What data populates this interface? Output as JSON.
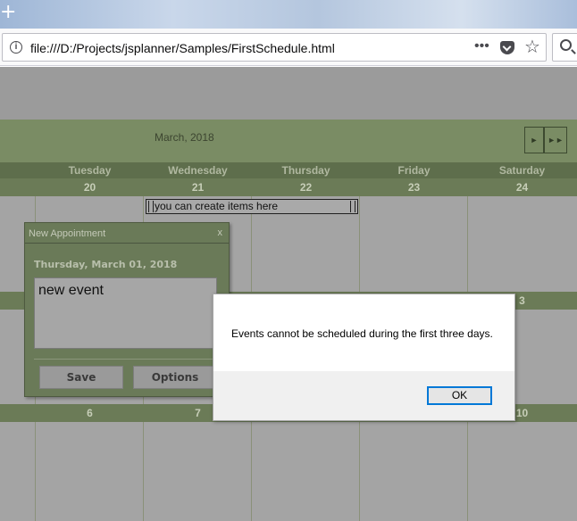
{
  "browser": {
    "url": "file:///D:/Projects/jsplanner/Samples/FirstSchedule.html",
    "more_glyph": "•••",
    "star_glyph": "☆",
    "plus_glyph": "+",
    "info_glyph": "i"
  },
  "calendar": {
    "month": "March, 2018",
    "nav_next": "►",
    "nav_fast": "►►",
    "day_names": [
      "Tuesday",
      "Wednesday",
      "Thursday",
      "Friday",
      "Saturday"
    ],
    "week1_dates": [
      "20",
      "21",
      "22",
      "23",
      "24"
    ],
    "week2_dates": [
      "3"
    ],
    "week3_dates": [
      "6",
      "7",
      "10"
    ],
    "item_text": "you can create items here"
  },
  "appointment": {
    "title": "New Appointment",
    "close": "x",
    "date": "Thursday, March 01, 2018",
    "text": "new event",
    "save_label": "Save",
    "options_label": "Options"
  },
  "dialog": {
    "message": "Events cannot be scheduled during the first three days.",
    "ok_label": "OK"
  },
  "colors": {
    "header_green": "#7a8c64",
    "dayname_bar": "#5e6e4c",
    "date_bar": "#6b7b57",
    "accent_blue": "#0078d7"
  }
}
